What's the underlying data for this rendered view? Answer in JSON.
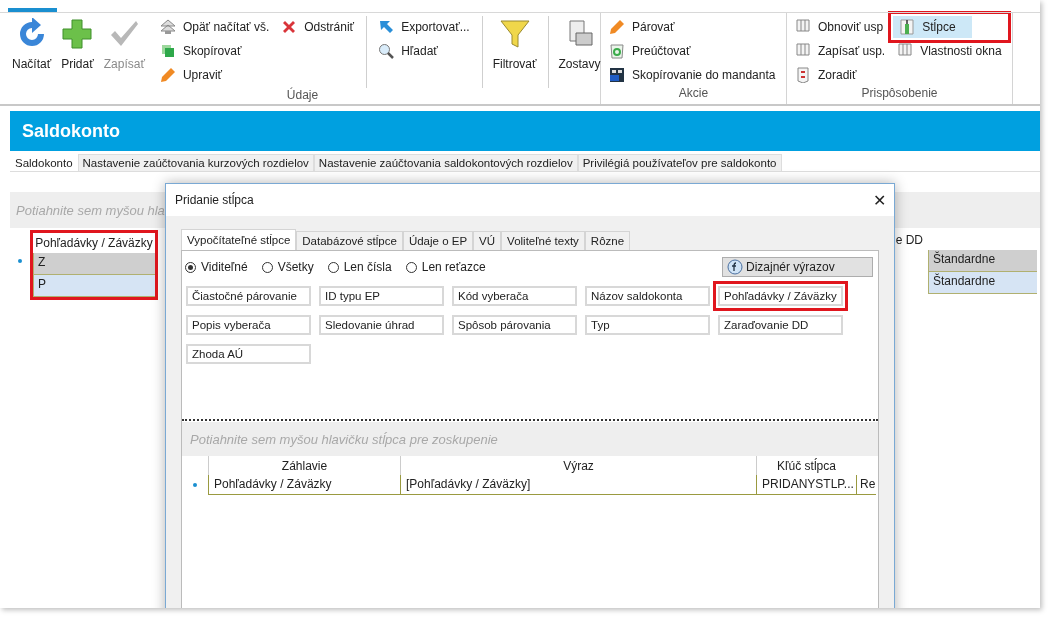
{
  "ribbon": {
    "groups": [
      {
        "label": "Údaje",
        "sections": [
          {
            "kind": "large",
            "items": [
              {
                "label": "Načítať",
                "disabled": false
              },
              {
                "label": "Pridať",
                "disabled": false
              },
              {
                "label": "Zapísať",
                "disabled": true
              }
            ]
          },
          {
            "kind": "small",
            "columns": [
              [
                {
                  "label": "Opäť načítať vš."
                },
                {
                  "label": "Skopírovať"
                },
                {
                  "label": "Upraviť"
                }
              ],
              [
                {
                  "label": "Odstrániť"
                }
              ]
            ]
          },
          {
            "kind": "small",
            "columns": [
              [
                {
                  "label": "Exportovať..."
                },
                {
                  "label": "Hľadať"
                }
              ]
            ]
          },
          {
            "kind": "large",
            "items": [
              {
                "label": "Filtrovať",
                "disabled": false
              }
            ]
          },
          {
            "kind": "large",
            "items": [
              {
                "label": "Zostavy",
                "disabled": false
              }
            ]
          }
        ]
      },
      {
        "label": "Akcie",
        "sections": [
          {
            "kind": "small",
            "columns": [
              [
                {
                  "label": "Párovať"
                },
                {
                  "label": "Preúčtovať"
                },
                {
                  "label": "Skopírovanie do mandanta"
                }
              ]
            ]
          }
        ]
      },
      {
        "label": "Prispôsobenie",
        "sections": [
          {
            "kind": "small",
            "columns": [
              [
                {
                  "label": "Obnoviť usp",
                  "marked": false
                },
                {
                  "label": "Zapísať usp.",
                  "marked": false
                },
                {
                  "label": "Zoradiť",
                  "marked": false
                }
              ],
              [
                {
                  "label": "Stĺpce",
                  "marked": true
                },
                {
                  "label": "Vlastnosti okna",
                  "marked": false
                }
              ]
            ]
          }
        ]
      }
    ]
  },
  "page": {
    "title": "Saldokonto",
    "tabs": [
      {
        "label": "Saldokonto",
        "selected": true
      },
      {
        "label": "Nastavenie zaúčtovania kurzových rozdielov",
        "selected": false
      },
      {
        "label": "Nastavenie zaúčtovania saldokontových rozdielov",
        "selected": false
      },
      {
        "label": "Privilégiá používateľov pre saldokonto",
        "selected": false
      }
    ],
    "group_hint": "Potiahnite sem myšou hla",
    "columns": [
      {
        "header": "Pohľadávky / Záväzky",
        "marked": true
      },
      {
        "header": "e DD",
        "marked": false
      },
      {
        "marked": false
      }
    ],
    "rows": [
      {
        "focused": true,
        "selected": false,
        "cells": [
          "Z",
          null,
          "Štandardne"
        ]
      },
      {
        "focused": false,
        "selected": true,
        "cells": [
          "P",
          null,
          "Štandardne"
        ]
      }
    ]
  },
  "dialog": {
    "title": "Pridanie stĺpca",
    "close": "✕",
    "tabs": [
      {
        "label": "Vypočítateľné stĺpce",
        "selected": true
      },
      {
        "label": "Databázové stĺpce",
        "selected": false
      },
      {
        "label": "Údaje o EP",
        "selected": false
      },
      {
        "label": "VÚ",
        "selected": false
      },
      {
        "label": "Voliteľné texty",
        "selected": false
      },
      {
        "label": "Rôzne",
        "selected": false
      }
    ],
    "filters": [
      {
        "label": "Viditeľné",
        "selected": true
      },
      {
        "label": "Všetky",
        "selected": false
      },
      {
        "label": "Len čísla",
        "selected": false
      },
      {
        "label": "Len reťazce",
        "selected": false
      }
    ],
    "designer_button": "Dizajnér výrazov",
    "fields": [
      {
        "label": "Čiastočné párovanie",
        "marked": false
      },
      {
        "label": "ID typu EP",
        "marked": false
      },
      {
        "label": "Kód vyberača",
        "marked": false
      },
      {
        "label": "Názov saldokonta",
        "marked": false
      },
      {
        "label": "Pohľadávky / Záväzky",
        "marked": true
      },
      {
        "label": "Popis vyberača",
        "marked": false
      },
      {
        "label": "Sledovanie úhrad",
        "marked": false
      },
      {
        "label": "Spôsob párovania",
        "marked": false
      },
      {
        "label": "Typ",
        "marked": false
      },
      {
        "label": "Zaraďovanie DD",
        "marked": false
      },
      {
        "label": "Zhoda AÚ",
        "marked": false
      }
    ],
    "group_hint": "Potiahnite sem myšou hlavičku stĺpca pre zoskupenie",
    "columns": [
      "Záhlavie",
      "Výraz",
      "Kľúč stĺpca"
    ],
    "rows": [
      {
        "focused": true,
        "cells": [
          "Pohľadávky / Záväzky",
          "[Pohľadávky / Záväzky]",
          "PRIDANYSTLP...",
          "Re"
        ]
      }
    ]
  }
}
